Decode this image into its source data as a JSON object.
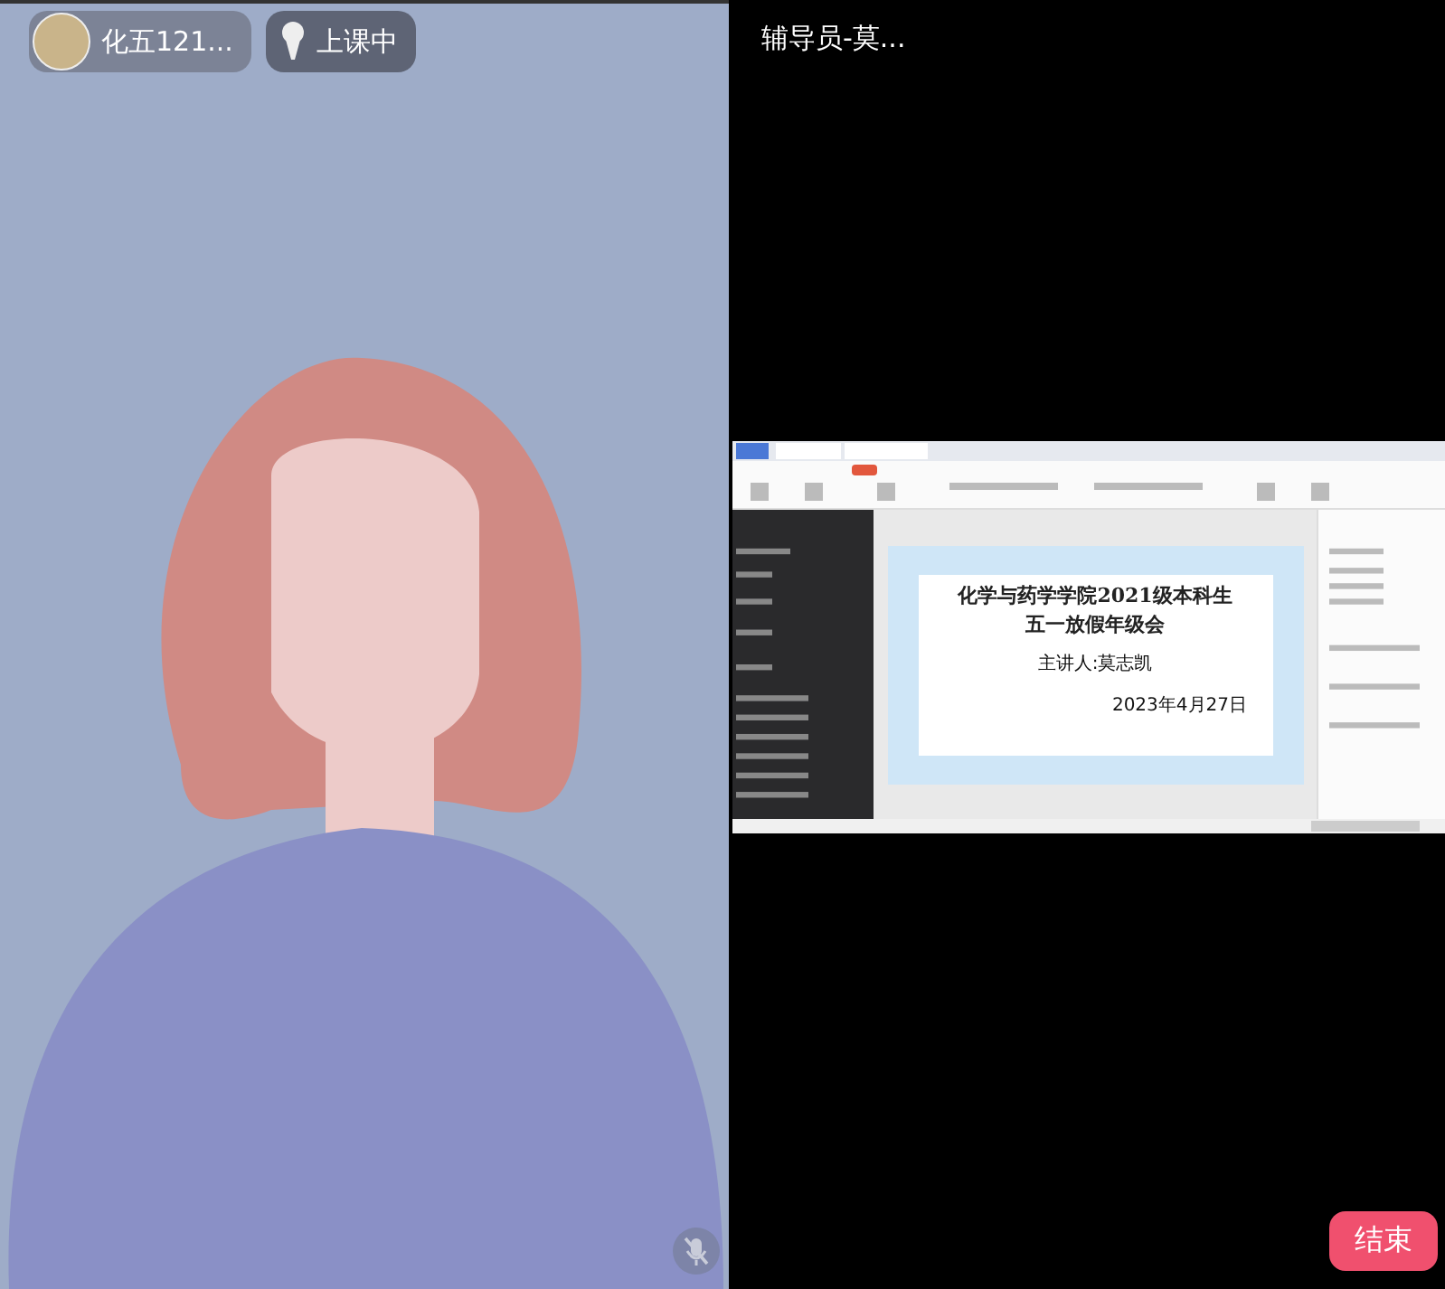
{
  "local_tile": {
    "name_badge": "化五121...",
    "status_badge": "上课中",
    "mic_muted": true
  },
  "remote_tile": {
    "name": "辅导员-莫...",
    "shared_screen": {
      "slide": {
        "title_lines": [
          "化学与药学学院2021级本科生",
          "五一放假年级会"
        ],
        "presenter": "主讲人:莫志凯",
        "date": "2023年4月27日"
      }
    }
  },
  "end_button": "结束"
}
